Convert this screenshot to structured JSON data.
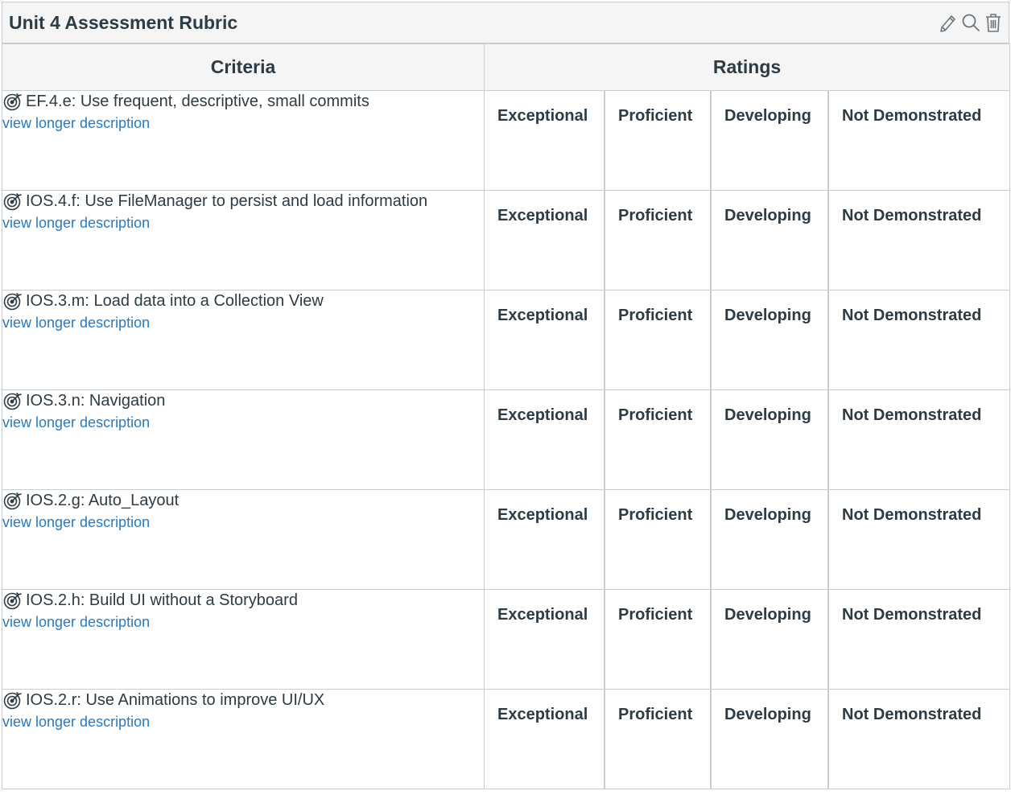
{
  "rubric": {
    "title": "Unit 4 Assessment Rubric",
    "toolbar": {
      "icons": [
        "pencil-icon",
        "magnifier-icon",
        "trash-icon"
      ]
    },
    "headers": {
      "criteria": "Criteria",
      "ratings": "Ratings"
    },
    "description_link": "view longer description",
    "criteria": [
      {
        "text": "EF.4.e: Use frequent, descriptive, small commits",
        "ratings": [
          "Exceptional",
          "Proficient",
          "Developing",
          "Not Demonstrated"
        ]
      },
      {
        "text": "IOS.4.f: Use FileManager to persist and load information",
        "ratings": [
          "Exceptional",
          "Proficient",
          "Developing",
          "Not Demonstrated"
        ]
      },
      {
        "text": "IOS.3.m: Load data into a Collection View",
        "ratings": [
          "Exceptional",
          "Proficient",
          "Developing",
          "Not Demonstrated"
        ]
      },
      {
        "text": "IOS.3.n: Navigation",
        "ratings": [
          "Exceptional",
          "Proficient",
          "Developing",
          "Not Demonstrated"
        ]
      },
      {
        "text": "IOS.2.g: Auto_Layout",
        "ratings": [
          "Exceptional",
          "Proficient",
          "Developing",
          "Not Demonstrated"
        ]
      },
      {
        "text": "IOS.2.h: Build UI without a Storyboard",
        "ratings": [
          "Exceptional",
          "Proficient",
          "Developing",
          "Not Demonstrated"
        ]
      },
      {
        "text": "IOS.2.r: Use Animations to improve UI/UX",
        "ratings": [
          "Exceptional",
          "Proficient",
          "Developing",
          "Not Demonstrated"
        ]
      }
    ]
  },
  "colors": {
    "text": "#2d3b45",
    "link": "#2b7abc",
    "border": "#c7cdd1",
    "header_bg": "#f5f5f5"
  }
}
